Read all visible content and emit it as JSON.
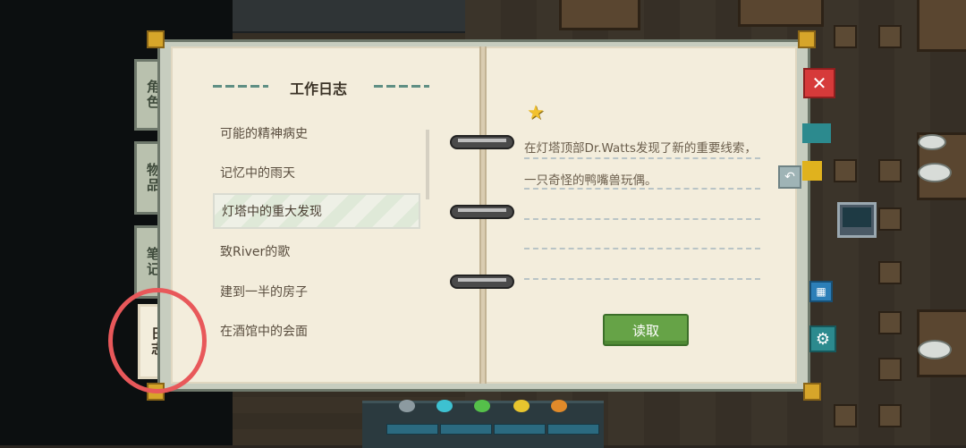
{
  "tabs": [
    {
      "label": "角色"
    },
    {
      "label": "物品"
    },
    {
      "label": "笔记"
    },
    {
      "label": "日志"
    }
  ],
  "journal": {
    "title": "工作日志",
    "entries": [
      {
        "label": "可能的精神病史"
      },
      {
        "label": "记忆中的雨天"
      },
      {
        "label": "灯塔中的重大发现"
      },
      {
        "label": "致River的歌"
      },
      {
        "label": "建到一半的房子"
      },
      {
        "label": "在酒馆中的会面"
      }
    ],
    "selected_index": 2
  },
  "note": {
    "line1": "在灯塔顶部Dr.Watts发现了新的重要线索，",
    "line2": "一只奇怪的鸭嘴兽玩偶。"
  },
  "read_button": {
    "label": "读取"
  },
  "close_button": {
    "label": "✕"
  },
  "icons": {
    "close": "close-icon",
    "back": "back-arrow-icon",
    "gear": "gear-icon",
    "star": "star-icon",
    "monitor": "monitor-icon",
    "qr": "qr-code-icon"
  },
  "colors": {
    "accent_green": "#66a347",
    "close_red": "#d63a3a",
    "highlight_circle": "#e8585a",
    "gold": "#d6a52a"
  }
}
